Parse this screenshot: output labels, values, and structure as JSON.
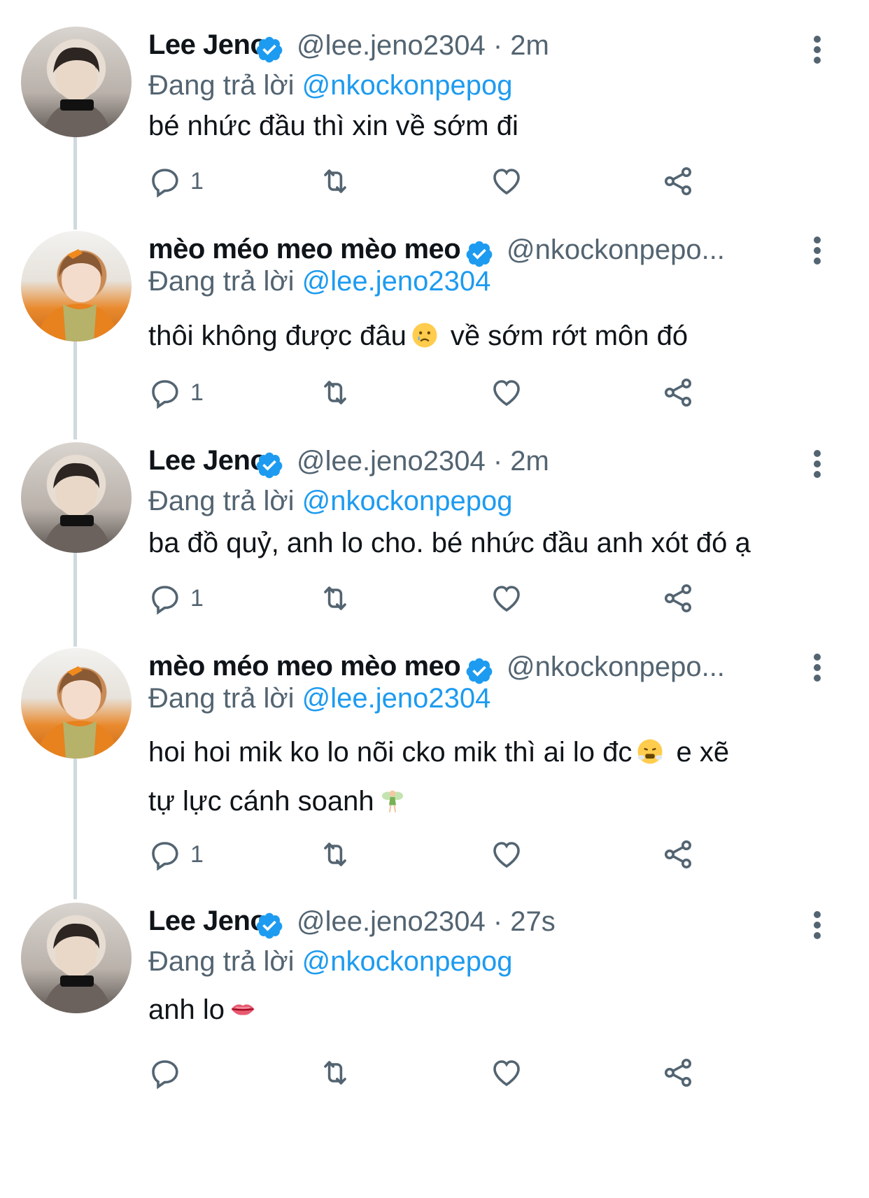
{
  "colors": {
    "accent": "#1d9bf0",
    "secondary_text": "#536471",
    "thread_line": "#cfd9de"
  },
  "tweets": [
    {
      "name": "Lee Jeno",
      "handle_meta": "@lee.jeno2304 · 2m",
      "reply_prefix": "Đang trả lời ",
      "mention": "@nkockonpepog",
      "text": "bé nhức đầu thì xin về sớm đi",
      "reply_count": "1",
      "avatar_icon": "avatar-jeno"
    },
    {
      "name": "mèo méo meo mèo meo",
      "handle_meta": "@nkockonpepo...",
      "reply_prefix": "Đang trả lời ",
      "mention": "@lee.jeno2304",
      "text_a": "thôi không được đâu",
      "text_b": " về sớm rớt môn đó",
      "emoji": "crying-face-emoji",
      "reply_count": "1",
      "avatar_icon": "avatar-meo"
    },
    {
      "name": "Lee Jeno",
      "handle_meta": "@lee.jeno2304 · 2m",
      "reply_prefix": "Đang trả lời ",
      "mention": "@nkockonpepog",
      "text": "ba đồ quỷ, anh lo cho. bé nhức đầu anh xót đó ạ",
      "reply_count": "1",
      "avatar_icon": "avatar-jeno"
    },
    {
      "name": "mèo méo meo mèo meo",
      "handle_meta": "@nkockonpepo...",
      "reply_prefix": "Đang trả lời ",
      "mention": "@lee.jeno2304",
      "text_line1a": "hoi hoi mik ko lo nõi cko mik thì ai lo đc",
      "text_line1b": " e xẽ",
      "text_line2": "tự lực cánh soanh",
      "emoji1": "steam-face-emoji",
      "emoji2": "fairy-emoji",
      "reply_count": "1",
      "avatar_icon": "avatar-meo"
    },
    {
      "name": "Lee Jeno",
      "handle_meta": "@lee.jeno2304 · 27s",
      "reply_prefix": "Đang trả lời ",
      "mention": "@nkockonpepog",
      "text": "anh lo",
      "emoji": "lips-emoji",
      "reply_count": "",
      "avatar_icon": "avatar-jeno"
    }
  ]
}
